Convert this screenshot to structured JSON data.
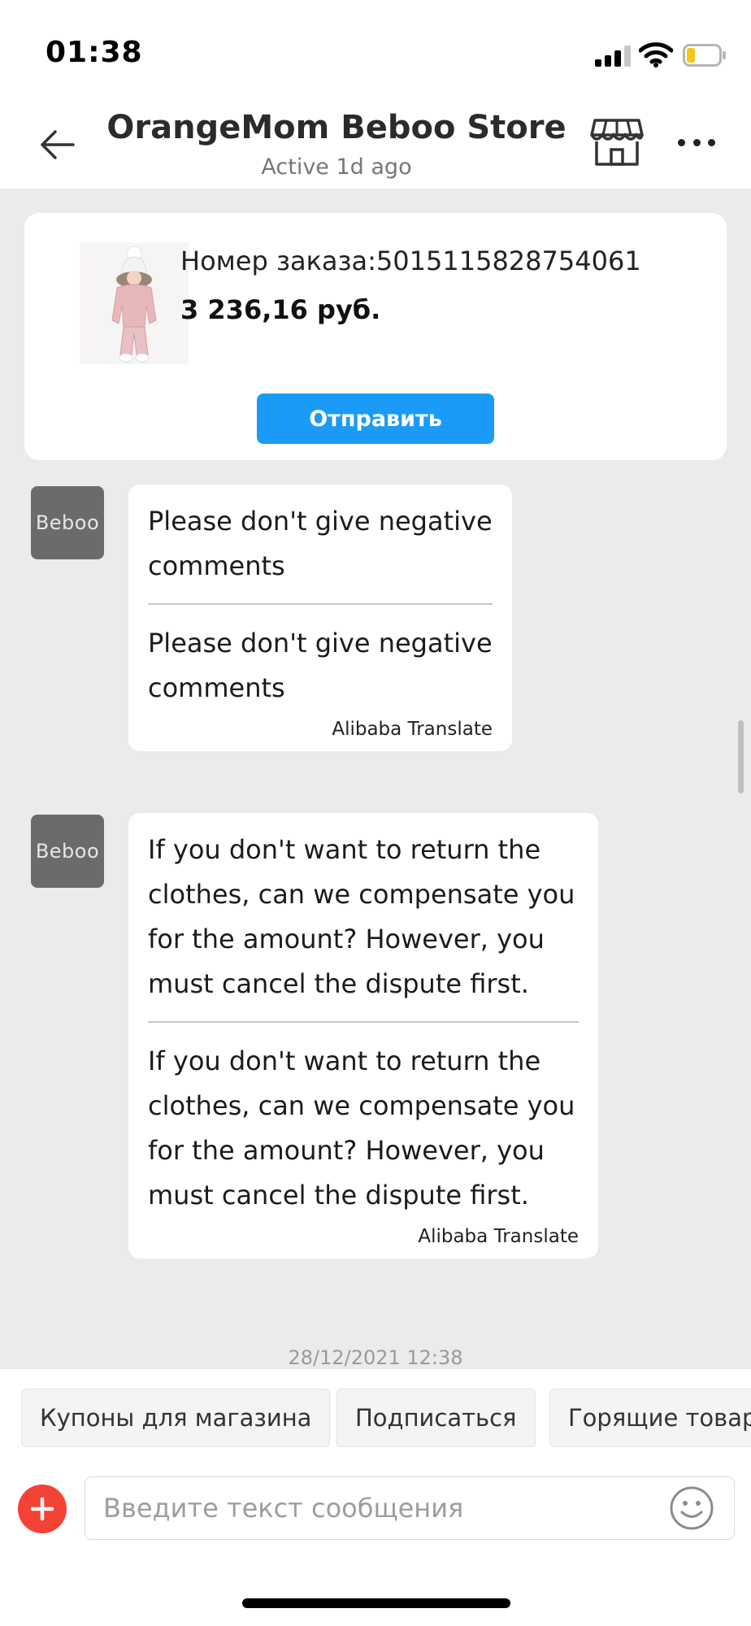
{
  "status_bar": {
    "time": "01:38"
  },
  "header": {
    "title": "OrangeMom Beboo Store",
    "subtitle": "Active 1d ago",
    "icons": {
      "back": "arrow-left-icon",
      "store": "storefront-icon",
      "more": "more-horizontal-icon"
    }
  },
  "order": {
    "number_text": "Номер заказа:5015115828754061",
    "price": "3 236,16 руб.",
    "send_label": "Отправить",
    "accent_color": "#1a9bf7"
  },
  "messages": [
    {
      "sender_avatar": "Beboo",
      "original": "Please don't give negative comments",
      "translated": "Please don't give negative comments",
      "translator": "Alibaba Translate"
    },
    {
      "sender_avatar": "Beboo",
      "original": "If you don't want to return the clothes, can we compensate you for the amount? However, you must cancel the dispute first.",
      "translated": "If you don't want to return the clothes, can we compensate you for the amount? However, you must cancel the dispute first.",
      "translator": "Alibaba Translate"
    }
  ],
  "timestamp": "28/12/2021 12:38",
  "quick_replies": [
    "Купоны для магазина",
    "Подписаться",
    "Горящие товары"
  ],
  "composer": {
    "placeholder": "Введите текст сообщения",
    "value": "",
    "plus_color": "#f44336",
    "icons": {
      "plus": "plus-circle-icon",
      "emoji": "smiley-icon"
    }
  }
}
